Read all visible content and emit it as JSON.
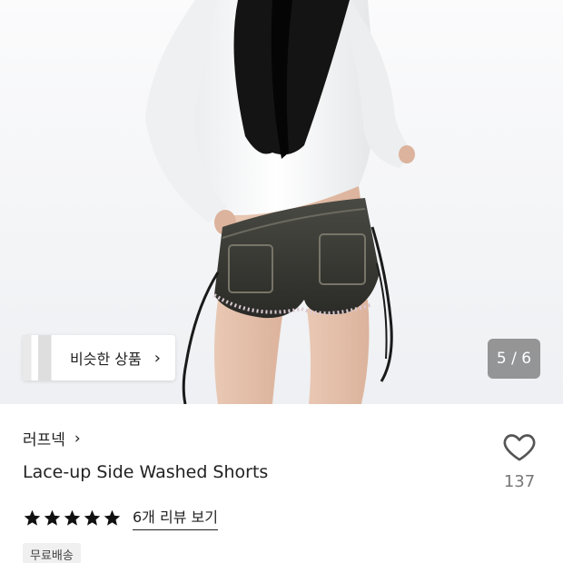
{
  "hero": {
    "image_alt": "Model wearing washed denim lace-up shorts and white top",
    "similar_products_label": "비슷한 상품",
    "similar_chevron": "›",
    "image_counter": "5 / 6"
  },
  "product": {
    "brand": "러프넥",
    "brand_chevron": "›",
    "title": "Lace-up Side Washed Shorts",
    "rating_stars": 5,
    "review_link": "6개 리뷰 보기",
    "badge": "무료배송"
  },
  "like": {
    "count": "137"
  },
  "colors": {
    "star": "#111111",
    "counter_bg": "#6e6e6e",
    "badge_bg": "#f0f0f0"
  }
}
